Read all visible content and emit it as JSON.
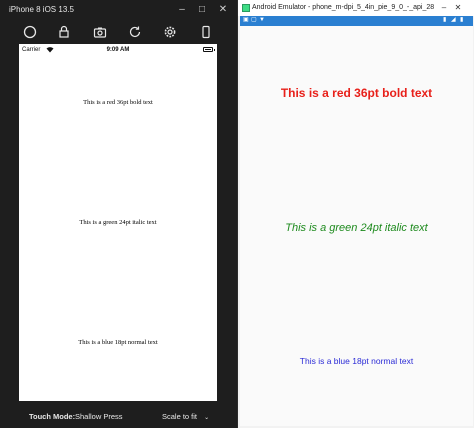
{
  "ios": {
    "window_title": "iPhone 8 iOS 13.5",
    "status": {
      "carrier": "Carrier",
      "time": "9:09 AM",
      "battery_level": 1.0
    },
    "texts": [
      "This is a red 36pt bold text",
      "This is a green 24pt italic text",
      "This is a blue 18pt normal text"
    ],
    "bottom_bar": {
      "touch_mode_label": "Touch Mode:",
      "touch_mode_value": "Shallow Press",
      "scale_label": "Scale to fit"
    },
    "toolbar_icons": [
      "power-icon",
      "lock-icon",
      "screenshot-icon",
      "rotate-icon",
      "settings-icon",
      "device-icon"
    ]
  },
  "android": {
    "window_title": "Android Emulator - phone_m-dpi_5_4in_pie_9_0_-_api_28",
    "status_bar_color": "#2a7fd1",
    "texts": {
      "red": "This is a red 36pt bold text",
      "green": "This is a green 24pt italic text",
      "blue": "This is a blue 18pt normal text"
    },
    "colors": {
      "red": "#e8201a",
      "green": "#1d8a1d",
      "blue": "#2b2bd6"
    }
  }
}
